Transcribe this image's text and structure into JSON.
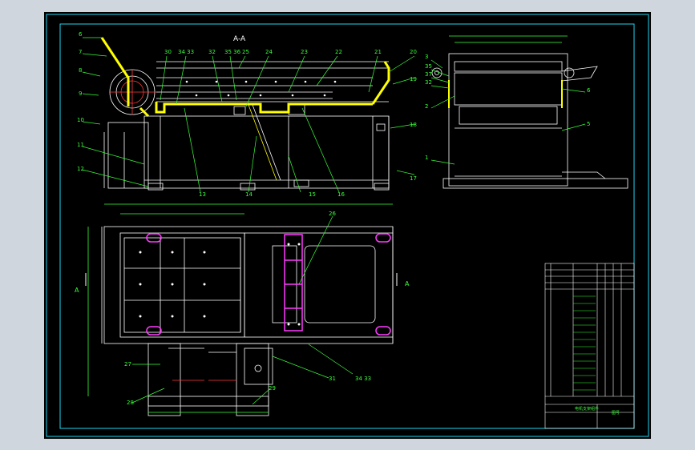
{
  "view_title": "A-A",
  "section_marker": "A",
  "top_callouts": [
    "6",
    "7",
    "8",
    "9",
    "10",
    "11",
    "12",
    "30",
    "34 33",
    "32",
    "35 36",
    "25",
    "24",
    "23",
    "22",
    "21",
    "20",
    "19",
    "18",
    "17"
  ],
  "bottom_callouts": [
    "13",
    "14",
    "15",
    "16"
  ],
  "side_callouts": [
    "3",
    "35",
    "37",
    "32",
    "2",
    "1",
    "6",
    "5"
  ],
  "plan_callouts": [
    "28",
    "27",
    "26",
    "31",
    "34 33",
    "29"
  ],
  "title_block": {
    "name": "电机支架组件",
    "drawing_no": "图号"
  },
  "colors": {
    "outline": "#ffffff",
    "green": "#39ff39",
    "yellow": "#ffff00",
    "red": "#ff3b3b",
    "magenta": "#ff3bff",
    "cyan": "#22d3ee"
  }
}
